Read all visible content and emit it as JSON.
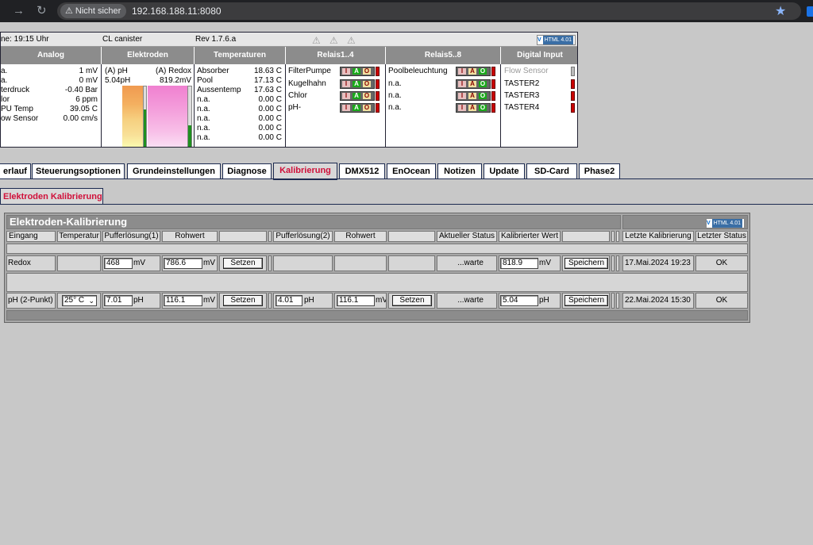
{
  "browser": {
    "security_label": "Nicht sicher",
    "url": "192.168.188.11:8080"
  },
  "status": {
    "time": "ne: 19:15 Uhr",
    "device": "CL canister",
    "revision": "Rev 1.7.6.a",
    "html_badge": "HTML 4.01",
    "headers": {
      "analog": "Analog",
      "elektroden": "Elektroden",
      "temperaturen": "Temperaturen",
      "relais1": "Relais1..4",
      "relais2": "Relais5..8",
      "digital": "Digital Input"
    },
    "analog": [
      {
        "label": "a.",
        "value": "1 mV"
      },
      {
        "label": "a.",
        "value": "0 mV"
      },
      {
        "label": "terdruck",
        "value": "-0.40 Bar"
      },
      {
        "label": "lor",
        "value": "6 ppm"
      },
      {
        "label": "PU Temp",
        "value": "39.05 C"
      },
      {
        "label": "ow Sensor",
        "value": "0.00 cm/s"
      }
    ],
    "elektroden": {
      "ph_label": "(A) pH",
      "redox_label": "(A) Redox",
      "ph_value": "5.04pH",
      "redox_value": "819.2mV",
      "ph_level": 0.62,
      "redox_level": 0.35
    },
    "temperaturen": [
      {
        "label": "Absorber",
        "value": "18.63 C"
      },
      {
        "label": "Pool",
        "value": "17.13 C"
      },
      {
        "label": "Aussentemp",
        "value": "17.63 C"
      },
      {
        "label": "n.a.",
        "value": "0.00 C"
      },
      {
        "label": "n.a.",
        "value": "0.00 C"
      },
      {
        "label": "n.a.",
        "value": "0.00 C"
      },
      {
        "label": "n.a.",
        "value": "0.00 C"
      },
      {
        "label": "n.a.",
        "value": "0.00 C"
      }
    ],
    "relais1": [
      {
        "label": "FilterPumpe",
        "active": "A"
      },
      {
        "label": "Kugelhahn",
        "active": "A"
      },
      {
        "label": "Chlor",
        "active": "A"
      },
      {
        "label": "pH-",
        "active": "A"
      }
    ],
    "relais2": [
      {
        "label": "Poolbeleuchtung",
        "active": "O"
      },
      {
        "label": "n.a.",
        "active": "O"
      },
      {
        "label": "n.a.",
        "active": "O"
      },
      {
        "label": "n.a.",
        "active": "O"
      }
    ],
    "iao_letters": [
      "I",
      "A",
      "O"
    ],
    "digital": [
      {
        "label": "Flow Sensor",
        "state": "off"
      },
      {
        "label": "TASTER2",
        "state": "red"
      },
      {
        "label": "TASTER3",
        "state": "red"
      },
      {
        "label": "TASTER4",
        "state": "red"
      }
    ]
  },
  "tabs": [
    {
      "label": "erlauf",
      "active": false
    },
    {
      "label": "Steuerungsoptionen",
      "active": false
    },
    {
      "label": "Grundeinstellungen",
      "active": false
    },
    {
      "label": "Diagnose",
      "active": false
    },
    {
      "label": "Kalibrierung",
      "active": true
    },
    {
      "label": "DMX512",
      "active": false
    },
    {
      "label": "EnOcean",
      "active": false
    },
    {
      "label": "Notizen",
      "active": false
    },
    {
      "label": "Update",
      "active": false
    },
    {
      "label": "SD-Card",
      "active": false
    },
    {
      "label": "Phase2",
      "active": false
    }
  ],
  "subtab": {
    "label": "Elektroden Kalibrierung"
  },
  "kalibrierung": {
    "title": "Elektroden-Kalibrierung",
    "html_badge": "HTML 4.01",
    "columns": [
      "Eingang",
      "Temperatur",
      "Pufferlösung(1)",
      "Rohwert",
      "",
      "Pufferlösung(2)",
      "Rohwert",
      "",
      "Aktueller Status",
      "Kalibrierter Wert",
      "",
      "Letzte Kalibrierung",
      "Letzter Status"
    ],
    "rows": [
      {
        "eingang": "Redox",
        "temperatur": "",
        "puffer1": "468",
        "puffer1_unit": "mV",
        "roh1": "786.6",
        "roh1_unit": "mV",
        "setzen1": "Setzen",
        "puffer2": "",
        "puffer2_unit": "",
        "roh2": "",
        "roh2_unit": "",
        "setzen2": "",
        "status": "...warte",
        "kal_wert": "818.9",
        "kal_unit": "mV",
        "speichern": "Speichern",
        "letzte": "17.Mai.2024 19:23",
        "letzter_status": "OK"
      },
      {
        "eingang": "pH (2-Punkt)",
        "temperatur": "25° C",
        "puffer1": "7.01",
        "puffer1_unit": "pH",
        "roh1": "116.1",
        "roh1_unit": "mV",
        "setzen1": "Setzen",
        "puffer2": "4.01",
        "puffer2_unit": "pH",
        "roh2": "116.1",
        "roh2_unit": "mV",
        "setzen2": "Setzen",
        "status": "...warte",
        "kal_wert": "5.04",
        "kal_unit": "pH",
        "speichern": "Speichern",
        "letzte": "22.Mai.2024 15:30",
        "letzter_status": "OK"
      }
    ]
  },
  "colors": {
    "accent_red": "#d0103a",
    "green_on": "#1aa81a",
    "relay_red": "#c00000",
    "header_gray": "#8c8c8c"
  }
}
